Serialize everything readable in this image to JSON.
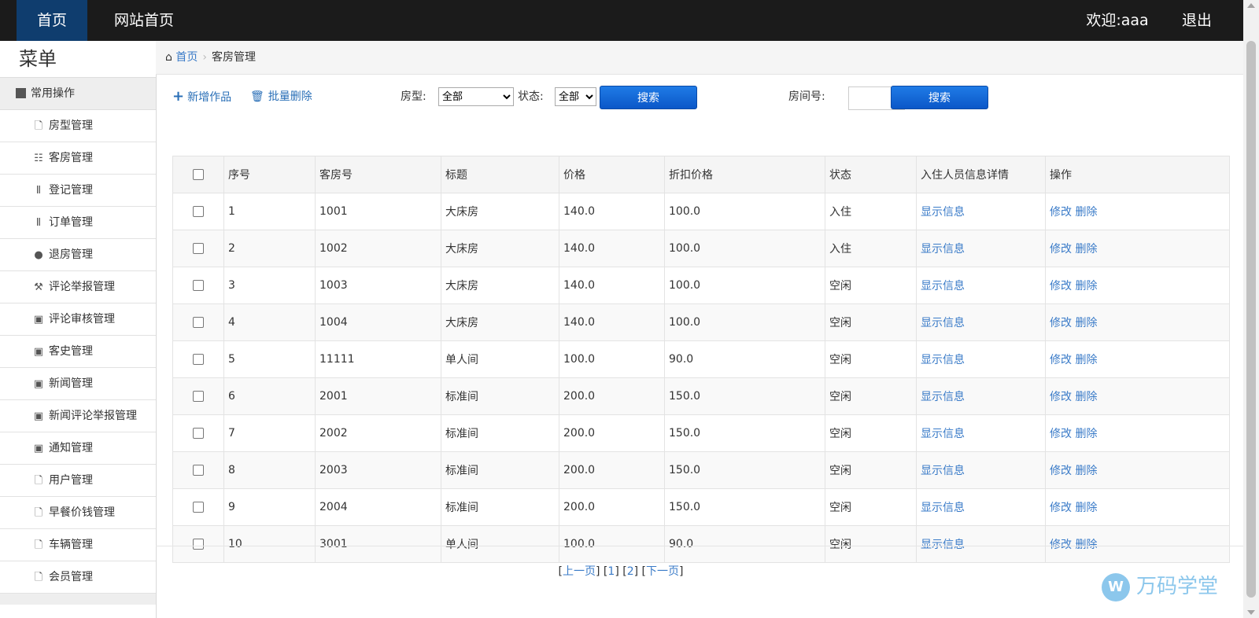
{
  "topnav": {
    "home": "首页",
    "site_home": "网站首页",
    "welcome": "欢迎:aaa",
    "logout": "退出"
  },
  "sidebar": {
    "title": "菜单",
    "group": "常用操作",
    "items": [
      {
        "label": "房型管理",
        "icon": "file-icon"
      },
      {
        "label": "客房管理",
        "icon": "list-icon"
      },
      {
        "label": "登记管理",
        "icon": "books-icon"
      },
      {
        "label": "订单管理",
        "icon": "books-icon"
      },
      {
        "label": "退房管理",
        "icon": "comment-icon"
      },
      {
        "label": "评论举报管理",
        "icon": "wrench-icon"
      },
      {
        "label": "评论审核管理",
        "icon": "picture-icon"
      },
      {
        "label": "客史管理",
        "icon": "picture-icon"
      },
      {
        "label": "新闻管理",
        "icon": "picture-icon"
      },
      {
        "label": "新闻评论举报管理",
        "icon": "picture-icon"
      },
      {
        "label": "通知管理",
        "icon": "picture-icon"
      },
      {
        "label": "用户管理",
        "icon": "file-icon"
      },
      {
        "label": "早餐价钱管理",
        "icon": "file-icon"
      },
      {
        "label": "车辆管理",
        "icon": "file-icon"
      },
      {
        "label": "会员管理",
        "icon": "file-icon"
      }
    ]
  },
  "breadcrumb": {
    "home": "首页",
    "current": "客房管理"
  },
  "toolbar": {
    "add_label": "新增作品",
    "batch_delete_label": "批量删除",
    "room_type_label": "房型:",
    "room_type_value": "全部",
    "status_label": "状态:",
    "status_value": "全部",
    "search_label": "搜索",
    "room_no_label": "房间号:",
    "room_no_value": "",
    "search2_label": "搜索"
  },
  "table": {
    "headers": [
      "序号",
      "客房号",
      "标题",
      "价格",
      "折扣价格",
      "状态",
      "入住人员信息详情",
      "操作"
    ],
    "rows": [
      {
        "no": "1",
        "room": "1001",
        "title": "大床房",
        "price": "140.0",
        "discount": "100.0",
        "status": "入住"
      },
      {
        "no": "2",
        "room": "1002",
        "title": "大床房",
        "price": "140.0",
        "discount": "100.0",
        "status": "入住"
      },
      {
        "no": "3",
        "room": "1003",
        "title": "大床房",
        "price": "140.0",
        "discount": "100.0",
        "status": "空闲"
      },
      {
        "no": "4",
        "room": "1004",
        "title": "大床房",
        "price": "140.0",
        "discount": "100.0",
        "status": "空闲"
      },
      {
        "no": "5",
        "room": "11111",
        "title": "单人间",
        "price": "100.0",
        "discount": "90.0",
        "status": "空闲"
      },
      {
        "no": "6",
        "room": "2001",
        "title": "标准间",
        "price": "200.0",
        "discount": "150.0",
        "status": "空闲"
      },
      {
        "no": "7",
        "room": "2002",
        "title": "标准间",
        "price": "200.0",
        "discount": "150.0",
        "status": "空闲"
      },
      {
        "no": "8",
        "room": "2003",
        "title": "标准间",
        "price": "200.0",
        "discount": "150.0",
        "status": "空闲"
      },
      {
        "no": "9",
        "room": "2004",
        "title": "标准间",
        "price": "200.0",
        "discount": "150.0",
        "status": "空闲"
      },
      {
        "no": "10",
        "room": "3001",
        "title": "单人间",
        "price": "100.0",
        "discount": "90.0",
        "status": "空闲"
      }
    ],
    "detail_link": "显示信息",
    "edit_link": "修改",
    "delete_link": "删除"
  },
  "pager": {
    "prev": "上一页",
    "page1": "1",
    "page2": "2",
    "next": "下一页"
  },
  "watermark": {
    "logo": "W",
    "text": "万码学堂"
  },
  "colors": {
    "link": "#3a7bc8",
    "topbar": "#1b1b1b",
    "active_tab": "#0f3d6e",
    "button": "#0b57c8"
  }
}
